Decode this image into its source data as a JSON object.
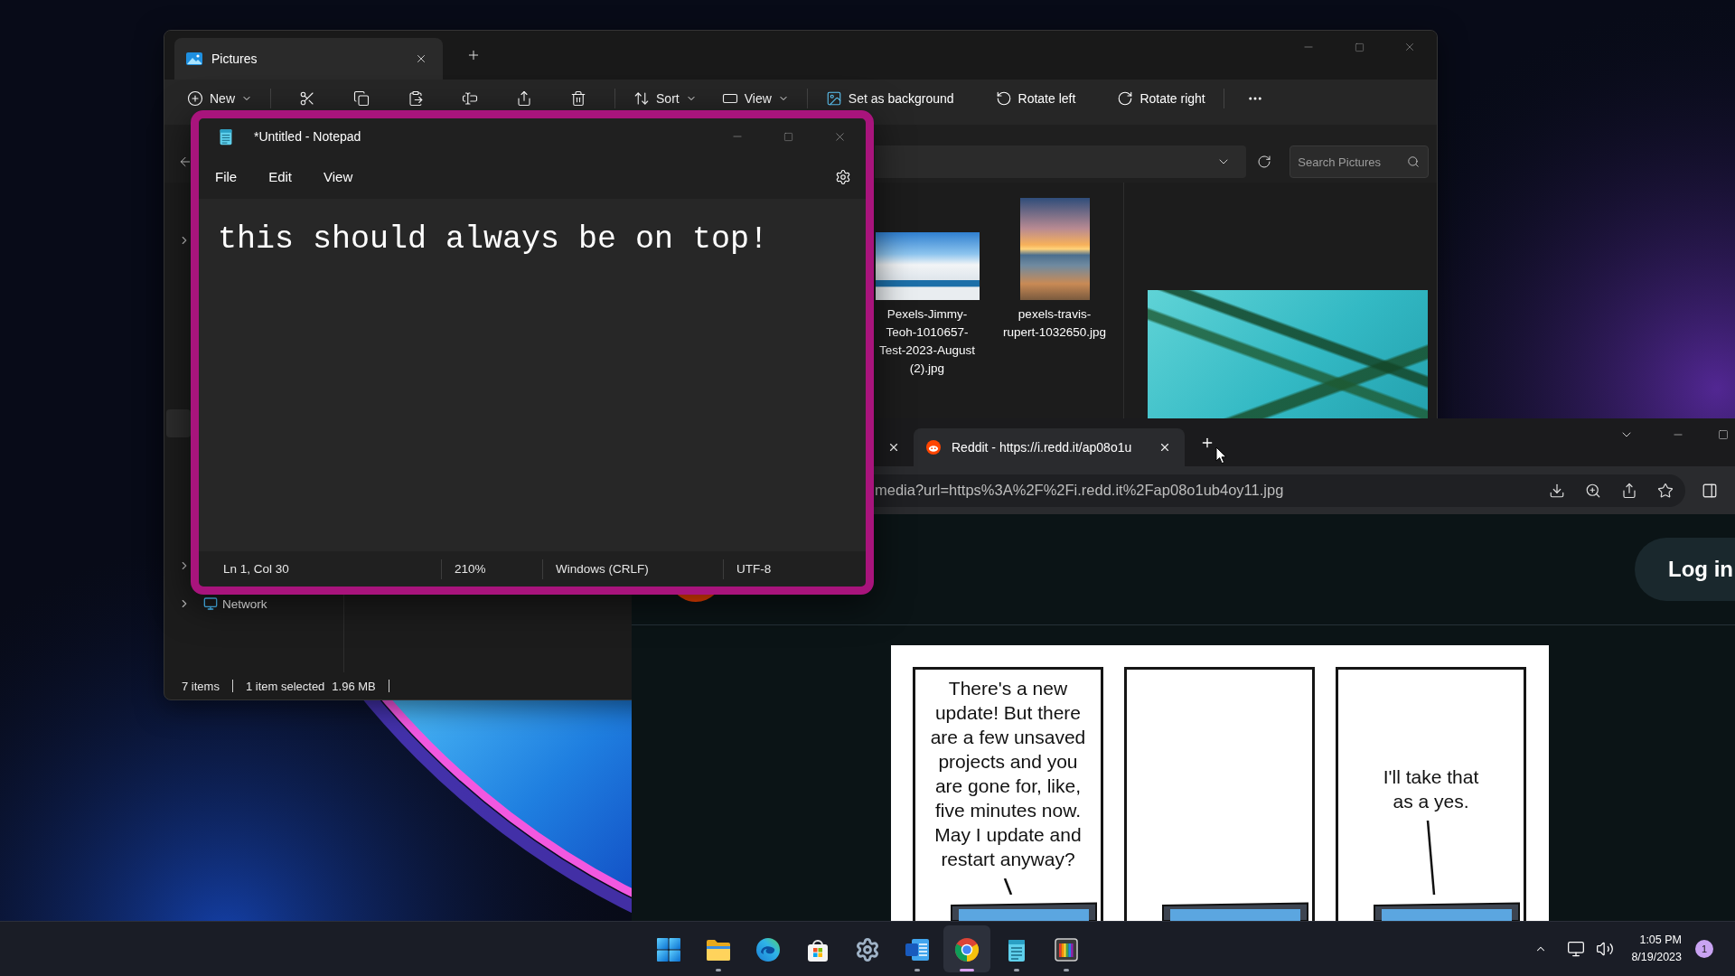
{
  "explorer": {
    "tabs": [
      {
        "title": "Pictures",
        "selected": true
      }
    ],
    "toolbar": {
      "new": "New",
      "sort": "Sort",
      "view": "View",
      "actions": [
        "Set as background",
        "Rotate left",
        "Rotate right"
      ]
    },
    "search": {
      "placeholder": "Search Pictures"
    },
    "nav": [
      {
        "expanded": false,
        "selected": false
      },
      {
        "selected": true
      },
      {
        "expanded": false,
        "selected": false
      },
      {
        "label": "Network",
        "expanded": false,
        "selected": false
      }
    ],
    "files": [
      {
        "name": "Pexels-Jimmy-Teoh-1010657-Test-2023-August (2).jpg",
        "selected": false
      },
      {
        "name": "pexels-travis-rupert-1032650.jpg",
        "selected": false
      }
    ],
    "status": {
      "count": "7 items",
      "selection": "1 item selected",
      "size": "1.96 MB"
    }
  },
  "notepad": {
    "title": "*Untitled - Notepad",
    "always_on_top": true,
    "menu": [
      "File",
      "Edit",
      "View"
    ],
    "text": "this should always be on top!",
    "status": [
      "Ln 1, Col 30",
      "210%",
      "Windows (CRLF)",
      "UTF-8"
    ]
  },
  "browser": {
    "tabs": [
      {
        "selected": false
      },
      {
        "title": "Reddit - https://i.redd.it/ap08o1u",
        "selected": true
      }
    ],
    "url": "media?url=https%3A%2F%2Fi.redd.it%2Fap08o1ub4oy11.jpg",
    "page": {
      "login": "Log in",
      "comic": {
        "panels": [
          {
            "kind": "speech",
            "text": "There's a new\nupdate! But there\nare a few unsaved\nprojects and you\nare gone for, like,\nfive minutes now.\nMay I update and\nrestart anyway?"
          },
          {
            "kind": "empty"
          },
          {
            "kind": "speech",
            "text": "I'll take that\nas a yes."
          }
        ]
      }
    }
  },
  "taskbar": {
    "apps": [
      {
        "running": false,
        "selected": false
      },
      {
        "running": true,
        "selected": false
      },
      {
        "running": false,
        "selected": false
      },
      {
        "running": false,
        "selected": false
      },
      {
        "running": false,
        "selected": false
      },
      {
        "running": true,
        "selected": false
      },
      {
        "running": true,
        "selected": true
      },
      {
        "running": true,
        "selected": false
      },
      {
        "running": true,
        "selected": false
      }
    ],
    "time": "1:05 PM",
    "date": "8/19/2023",
    "notifications": "1"
  }
}
